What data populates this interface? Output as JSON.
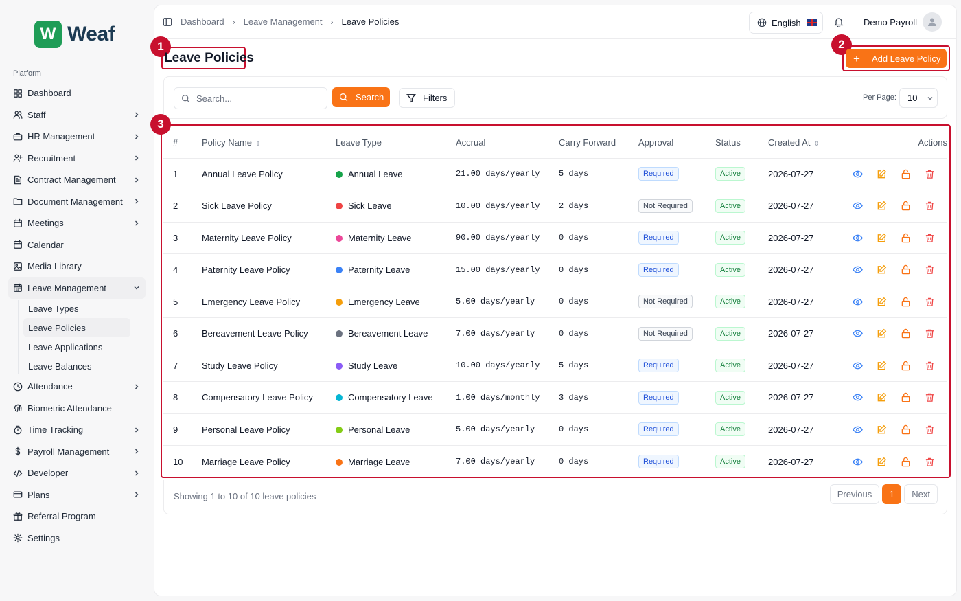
{
  "brand": {
    "logo_letter": "W",
    "name": "Weaf",
    "color": "#1f9d57"
  },
  "sidebar": {
    "section_label": "Platform",
    "items": [
      {
        "label": "Dashboard",
        "icon": "grid-icon",
        "chevron": false
      },
      {
        "label": "Staff",
        "icon": "users-icon",
        "chevron": true
      },
      {
        "label": "HR Management",
        "icon": "briefcase-icon",
        "chevron": true
      },
      {
        "label": "Recruitment",
        "icon": "user-plus-icon",
        "chevron": true
      },
      {
        "label": "Contract Management",
        "icon": "file-text-icon",
        "chevron": true
      },
      {
        "label": "Document Management",
        "icon": "folder-icon",
        "chevron": true
      },
      {
        "label": "Meetings",
        "icon": "calendar-icon",
        "chevron": true
      },
      {
        "label": "Calendar",
        "icon": "calendar-icon",
        "chevron": false
      },
      {
        "label": "Media Library",
        "icon": "image-icon",
        "chevron": false
      },
      {
        "label": "Leave Management",
        "icon": "calendar-days-icon",
        "chevron": true,
        "expanded": true
      }
    ],
    "leave_sub_items": [
      {
        "label": "Leave Types",
        "active": false
      },
      {
        "label": "Leave Policies",
        "active": true
      },
      {
        "label": "Leave Applications",
        "active": false
      },
      {
        "label": "Leave Balances",
        "active": false
      }
    ],
    "items_after": [
      {
        "label": "Attendance",
        "icon": "clock-icon",
        "chevron": true
      },
      {
        "label": "Biometric Attendance",
        "icon": "fingerprint-icon",
        "chevron": false
      },
      {
        "label": "Time Tracking",
        "icon": "timer-icon",
        "chevron": true
      },
      {
        "label": "Payroll Management",
        "icon": "dollar-icon",
        "chevron": true
      },
      {
        "label": "Developer",
        "icon": "code-icon",
        "chevron": true
      },
      {
        "label": "Plans",
        "icon": "credit-card-icon",
        "chevron": true
      },
      {
        "label": "Referral Program",
        "icon": "gift-icon",
        "chevron": false
      },
      {
        "label": "Settings",
        "icon": "gear-icon",
        "chevron": false
      }
    ]
  },
  "header": {
    "breadcrumb": [
      "Dashboard",
      "Leave Management",
      "Leave Policies"
    ],
    "language": "English",
    "user_name": "Demo Payroll"
  },
  "page": {
    "title": "Leave Policies",
    "add_button": "Add Leave Policy",
    "annotations": [
      "1",
      "2",
      "3"
    ]
  },
  "filters": {
    "search_placeholder": "Search...",
    "search_button": "Search",
    "filters_button": "Filters",
    "per_page_label": "Per Page:",
    "per_page_value": "10"
  },
  "table": {
    "columns": [
      "#",
      "Policy Name",
      "Leave Type",
      "Accrual",
      "Carry Forward",
      "Approval",
      "Status",
      "Created At",
      "Actions"
    ],
    "rows": [
      {
        "num": "1",
        "policy": "Annual Leave Policy",
        "type": "Annual Leave",
        "color": "#16a34a",
        "accrual": "21.00 days/yearly",
        "carry": "5 days",
        "approval": "Required",
        "status": "Active",
        "created": "2026-07-27"
      },
      {
        "num": "2",
        "policy": "Sick Leave Policy",
        "type": "Sick Leave",
        "color": "#ef4444",
        "accrual": "10.00 days/yearly",
        "carry": "2 days",
        "approval": "Not Required",
        "status": "Active",
        "created": "2026-07-27"
      },
      {
        "num": "3",
        "policy": "Maternity Leave Policy",
        "type": "Maternity Leave",
        "color": "#ec4899",
        "accrual": "90.00 days/yearly",
        "carry": "0 days",
        "approval": "Required",
        "status": "Active",
        "created": "2026-07-27"
      },
      {
        "num": "4",
        "policy": "Paternity Leave Policy",
        "type": "Paternity Leave",
        "color": "#3b82f6",
        "accrual": "15.00 days/yearly",
        "carry": "0 days",
        "approval": "Required",
        "status": "Active",
        "created": "2026-07-27"
      },
      {
        "num": "5",
        "policy": "Emergency Leave Policy",
        "type": "Emergency Leave",
        "color": "#f59e0b",
        "accrual": "5.00 days/yearly",
        "carry": "0 days",
        "approval": "Not Required",
        "status": "Active",
        "created": "2026-07-27"
      },
      {
        "num": "6",
        "policy": "Bereavement Leave Policy",
        "type": "Bereavement Leave",
        "color": "#6b7280",
        "accrual": "7.00 days/yearly",
        "carry": "0 days",
        "approval": "Not Required",
        "status": "Active",
        "created": "2026-07-27"
      },
      {
        "num": "7",
        "policy": "Study Leave Policy",
        "type": "Study Leave",
        "color": "#8b5cf6",
        "accrual": "10.00 days/yearly",
        "carry": "5 days",
        "approval": "Required",
        "status": "Active",
        "created": "2026-07-27"
      },
      {
        "num": "8",
        "policy": "Compensatory Leave Policy",
        "type": "Compensatory Leave",
        "color": "#06b6d4",
        "accrual": "1.00 days/monthly",
        "carry": "3 days",
        "approval": "Required",
        "status": "Active",
        "created": "2026-07-27"
      },
      {
        "num": "9",
        "policy": "Personal Leave Policy",
        "type": "Personal Leave",
        "color": "#84cc16",
        "accrual": "5.00 days/yearly",
        "carry": "0 days",
        "approval": "Required",
        "status": "Active",
        "created": "2026-07-27"
      },
      {
        "num": "10",
        "policy": "Marriage Leave Policy",
        "type": "Marriage Leave",
        "color": "#f97316",
        "accrual": "7.00 days/yearly",
        "carry": "0 days",
        "approval": "Required",
        "status": "Active",
        "created": "2026-07-27"
      }
    ]
  },
  "pagination": {
    "showing": "Showing 1 to 10 of 10 leave policies",
    "previous": "Previous",
    "current": "1",
    "next": "Next"
  },
  "colors": {
    "accent": "#f97316",
    "annotation": "#c8102e",
    "view": "#3b82f6",
    "edit": "#f59e0b",
    "lock": "#f97316",
    "delete": "#ef4444"
  }
}
